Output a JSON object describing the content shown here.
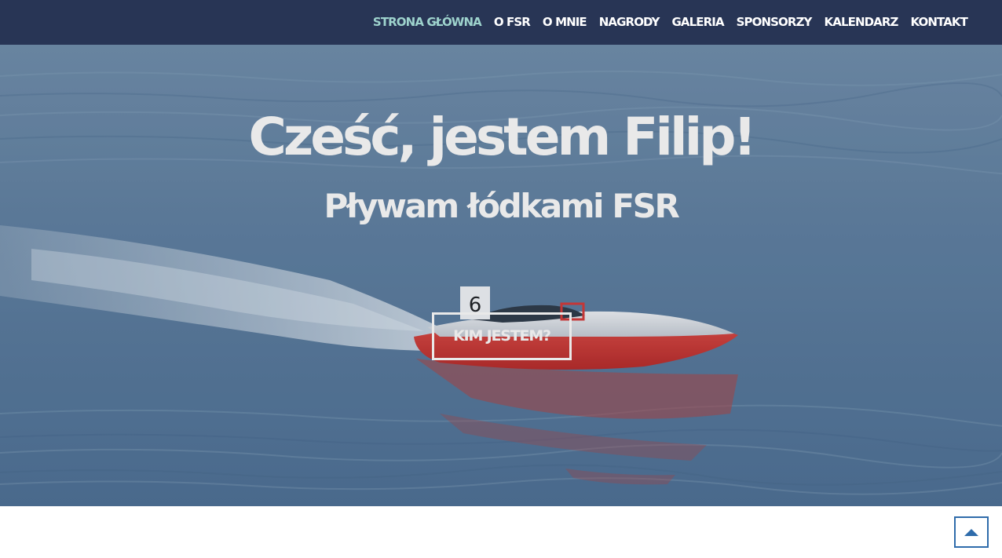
{
  "nav": {
    "items": [
      {
        "label": "STRONA GŁÓWNA",
        "active": true
      },
      {
        "label": "O FSR",
        "active": false
      },
      {
        "label": "O MNIE",
        "active": false
      },
      {
        "label": "NAGRODY",
        "active": false
      },
      {
        "label": "GALERIA",
        "active": false
      },
      {
        "label": "SPONSORZY",
        "active": false
      },
      {
        "label": "KALENDARZ",
        "active": false
      },
      {
        "label": "KONTAKT",
        "active": false
      }
    ]
  },
  "hero": {
    "title": "Cześć, jestem Filip!",
    "subtitle": "Pływam łódkami FSR",
    "button_label": "KIM JESTEM?",
    "boat_number": "6"
  },
  "back_to_top": {
    "icon": "arrow-up-icon"
  },
  "colors": {
    "navbar_bg": "#283555",
    "nav_active": "#9ed3cd",
    "nav_text": "#ffffff",
    "hero_text": "#e9e9e9",
    "boat_hull": "#d8332e",
    "back_to_top_border": "#2f6cab"
  }
}
